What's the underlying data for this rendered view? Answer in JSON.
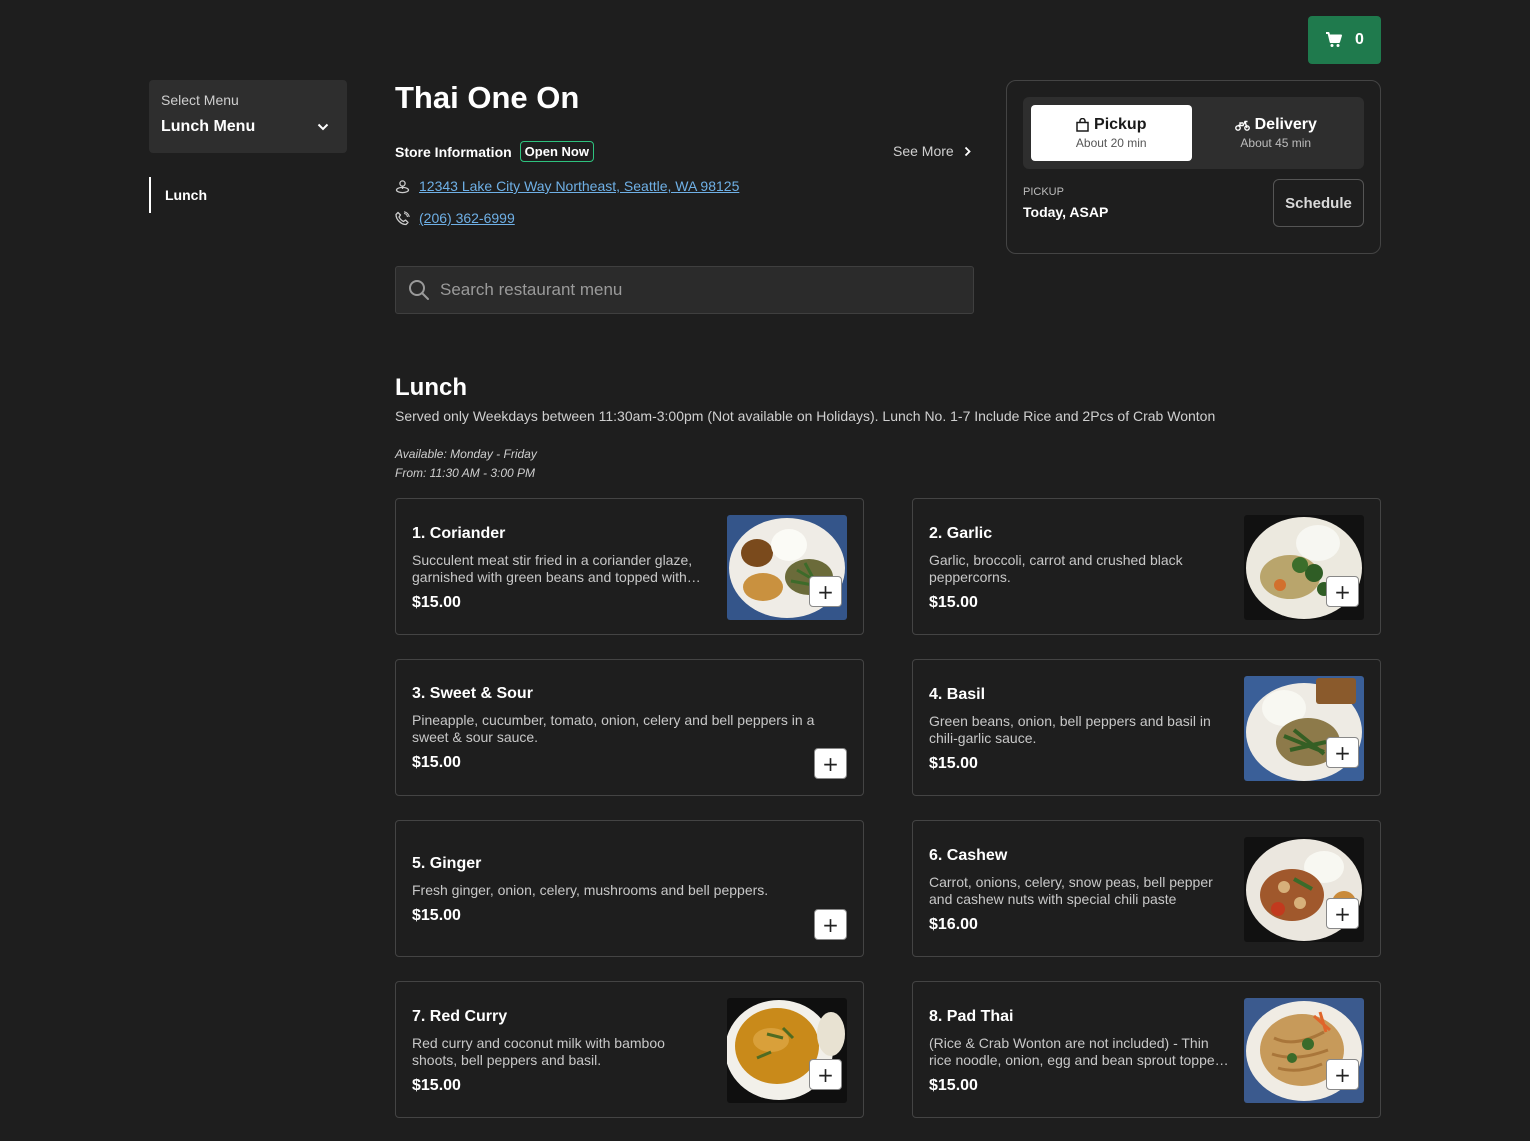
{
  "cart": {
    "count": "0",
    "icon": "cart-icon"
  },
  "sidebar": {
    "select_label": "Select Menu",
    "selected_menu": "Lunch Menu",
    "categories": [
      {
        "label": "Lunch"
      }
    ]
  },
  "store": {
    "name": "Thai One On",
    "info_label": "Store Information",
    "status": "Open Now",
    "see_more": "See More",
    "address": "12343 Lake City Way Northeast, Seattle, WA 98125",
    "phone": "(206) 362-6999"
  },
  "search": {
    "placeholder": "Search restaurant menu"
  },
  "order": {
    "modes": [
      {
        "label": "Pickup",
        "eta": "About 20 min",
        "active": true
      },
      {
        "label": "Delivery",
        "eta": "About 45 min",
        "active": false
      }
    ],
    "time_label": "PICKUP",
    "time_value": "Today, ASAP",
    "schedule_label": "Schedule"
  },
  "section": {
    "title": "Lunch",
    "description": "Served only Weekdays between 11:30am-3:00pm (Not available on Holidays). Lunch No. 1-7 Include Rice and 2Pcs of Crab Wonton",
    "available_days": "Available: Monday - Friday",
    "available_hours": "From: 11:30 AM - 3:00 PM"
  },
  "items": [
    {
      "name": "1. Coriander",
      "description": "Succulent meat stir fried in a coriander glaze, garnished with green beans and topped with crispy garlic.",
      "price": "$15.00",
      "has_image": true
    },
    {
      "name": "2. Garlic",
      "description": "Garlic, broccoli, carrot and crushed black peppercorns.",
      "price": "$15.00",
      "has_image": true
    },
    {
      "name": "3. Sweet & Sour",
      "description": "Pineapple, cucumber, tomato, onion, celery and bell peppers in a sweet & sour sauce.",
      "price": "$15.00",
      "has_image": false
    },
    {
      "name": "4. Basil",
      "description": "Green beans, onion, bell peppers and basil in chili-garlic sauce.",
      "price": "$15.00",
      "has_image": true
    },
    {
      "name": "5. Ginger",
      "description": "Fresh ginger, onion, celery, mushrooms and bell peppers.",
      "price": "$15.00",
      "has_image": false
    },
    {
      "name": "6. Cashew",
      "description": "Carrot, onions, celery, snow peas, bell pepper and cashew nuts with special chili paste",
      "price": "$16.00",
      "has_image": true
    },
    {
      "name": "7. Red Curry",
      "description": "Red curry and coconut milk with bamboo shoots, bell peppers and basil.",
      "price": "$15.00",
      "has_image": true
    },
    {
      "name": "8. Pad Thai",
      "description": "(Rice & Crab Wonton are not included) - Thin rice noodle, onion, egg and bean sprout topped with ground peanuts.",
      "price": "$15.00",
      "has_image": true
    }
  ],
  "add_label": "+"
}
